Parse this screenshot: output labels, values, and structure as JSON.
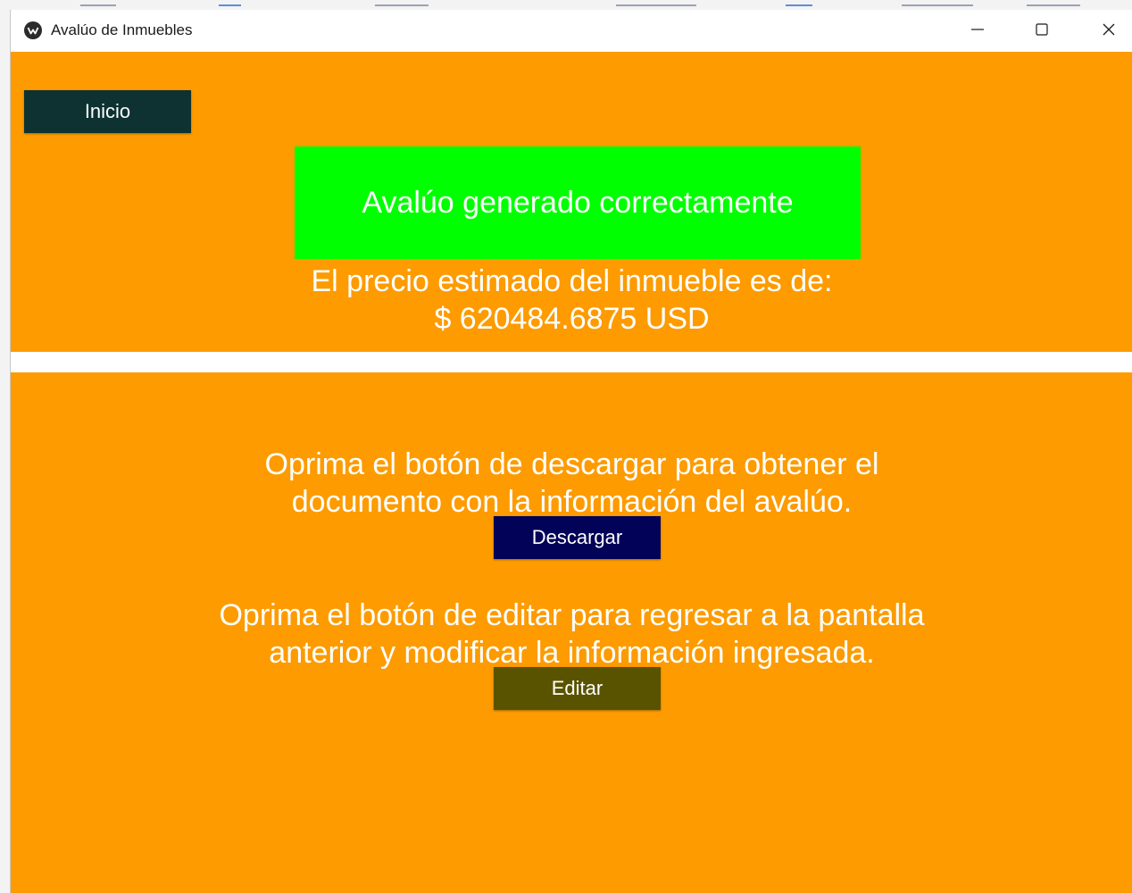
{
  "window": {
    "title": "Avalúo de Inmuebles"
  },
  "top": {
    "inicio_label": "Inicio",
    "status_message": "Avalúo generado correctamente",
    "price_line1": "El precio estimado del inmueble es de:",
    "price_line2": "$ 620484.6875 USD"
  },
  "bottom": {
    "download_line1": "Oprima el botón de descargar para obtener el",
    "download_line2": "documento con la información del avalúo.",
    "download_label": "Descargar",
    "edit_line1": "Oprima el botón de editar para regresar a la pantalla",
    "edit_line2": "anterior y modificar la información ingresada.",
    "edit_label": "Editar"
  },
  "colors": {
    "background": "#fd9b00",
    "success": "#00ff00",
    "inicio_button": "#0d3231",
    "download_button": "#020258",
    "edit_button": "#595300"
  },
  "icons": [
    "app-logo-icon",
    "minimize-icon",
    "maximize-icon",
    "close-icon"
  ]
}
